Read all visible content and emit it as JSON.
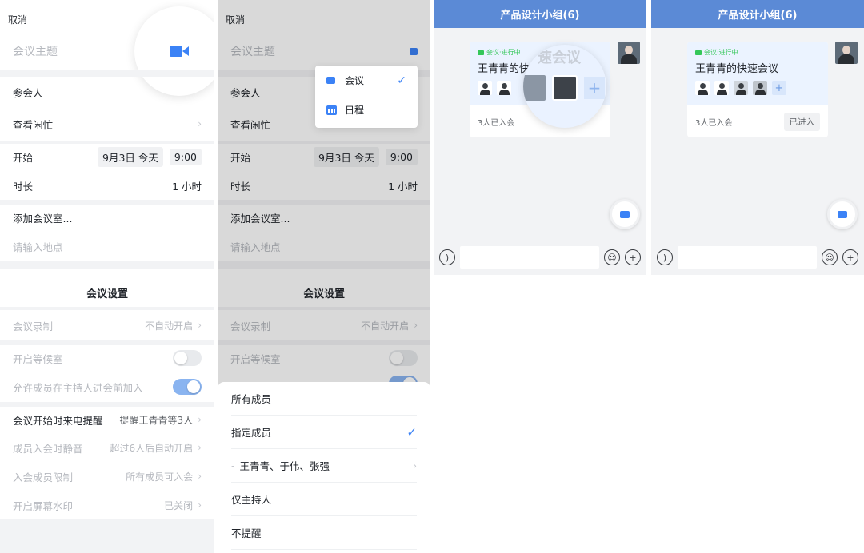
{
  "panel1": {
    "cancel": "取消",
    "subject_placeholder": "会议主题",
    "participants": "参会人",
    "check_busy": "查看闲忙",
    "start": "开始",
    "date": "9月3日 今天",
    "time": "9:00",
    "duration": "时长",
    "duration_value": "1 小时",
    "add_room": "添加会议室...",
    "location_placeholder": "请输入地点",
    "settings_title": "会议设置",
    "recording": "会议录制",
    "recording_value": "不自动开启",
    "waiting_room": "开启等候室",
    "allow_before_host": "允许成员在主持人进会前加入",
    "call_reminder": "会议开始时来电提醒",
    "call_reminder_value": "提醒王青青等3人",
    "mute_on_join": "成员入会时静音",
    "mute_on_join_value": "超过6人后自动开启",
    "join_limit": "入会成员限制",
    "join_limit_value": "所有成员可入会",
    "watermark": "开启屏幕水印",
    "watermark_value": "已关闭"
  },
  "panel2": {
    "dropdown": [
      {
        "label": "会议",
        "checked": true
      },
      {
        "label": "日程",
        "checked": false
      }
    ],
    "sheet": {
      "all_members": "所有成员",
      "specified_members": "指定成员",
      "member_names": "王青青、于伟、张强",
      "host_only": "仅主持人",
      "no_remind": "不提醒"
    }
  },
  "chat": {
    "group_title": "产品设计小组(6)",
    "status": "会议·进行中",
    "meeting_title": "王青青的快速会议",
    "meeting_title_partial": "王青青的快",
    "magnified_text": "速会议",
    "joined_count": "3人已入会",
    "joined_button": "已进入"
  },
  "icons": {
    "video": "video-camera-icon",
    "voice": "voice-icon",
    "emoji": "emoji-icon",
    "add": "plus-circle-icon",
    "calendar": "calendar-icon",
    "check": "check-icon"
  },
  "colors": {
    "accent": "#3b82f6",
    "header": "#5b8ad6",
    "green": "#34c759"
  }
}
